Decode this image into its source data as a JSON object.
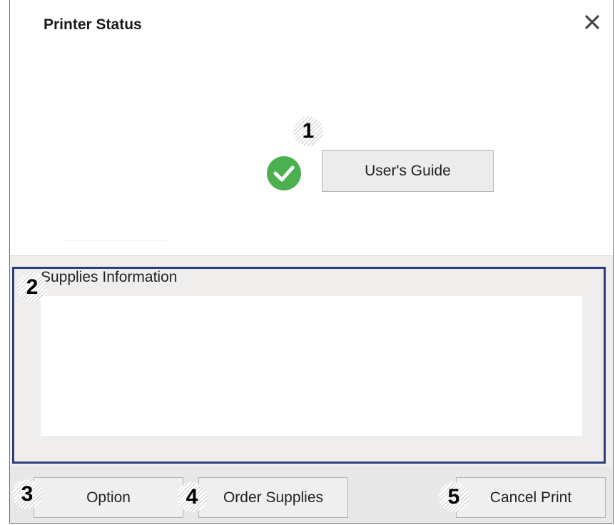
{
  "window": {
    "title": "Printer Status",
    "close_icon": "close-icon",
    "status_icon": "check-circle-icon",
    "accent_color": "#2c3e7e",
    "status_color": "#4caf50"
  },
  "status": {
    "guide_button_label": "User's Guide"
  },
  "supplies": {
    "label": "Supplies Information"
  },
  "buttons": {
    "option": "Option",
    "order": "Order Supplies",
    "cancel": "Cancel Print"
  },
  "callouts": [
    "1",
    "2",
    "3",
    "4",
    "5"
  ]
}
